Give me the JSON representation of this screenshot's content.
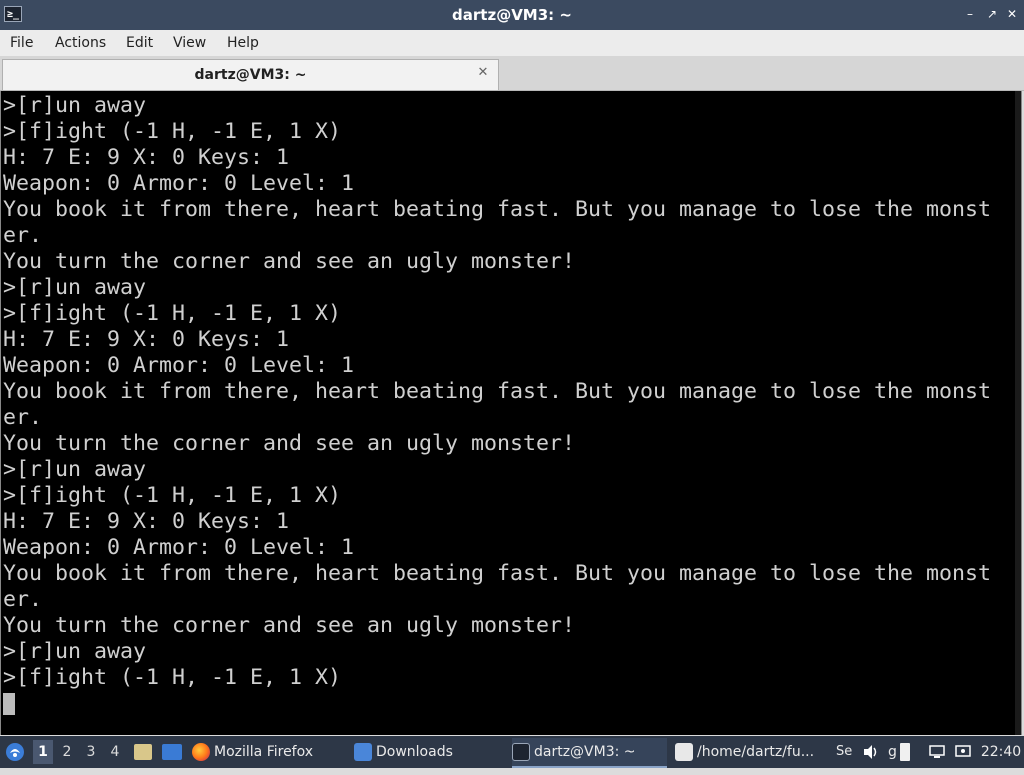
{
  "window": {
    "title": "dartz@VM3: ~",
    "app_icon_glyph": "≥_",
    "controls": [
      "–",
      "↗",
      "✕"
    ]
  },
  "menu": [
    "File",
    "Actions",
    "Edit",
    "View",
    "Help"
  ],
  "tab": {
    "label": "dartz@VM3: ~",
    "close_glyph": "✕"
  },
  "terminal": {
    "lines": [
      ">[r]un away",
      ">[f]ight (-1 H, -1 E, 1 X)",
      "H: 7 E: 9 X: 0 Keys: 1",
      "Weapon: 0 Armor: 0 Level: 1",
      "You book it from there, heart beating fast. But you manage to lose the monst",
      "er.",
      "You turn the corner and see an ugly monster!",
      ">[r]un away",
      ">[f]ight (-1 H, -1 E, 1 X)",
      "H: 7 E: 9 X: 0 Keys: 1",
      "Weapon: 0 Armor: 0 Level: 1",
      "You book it from there, heart beating fast. But you manage to lose the monst",
      "er.",
      "You turn the corner and see an ugly monster!",
      ">[r]un away",
      ">[f]ight (-1 H, -1 E, 1 X)",
      "H: 7 E: 9 X: 0 Keys: 1",
      "Weapon: 0 Armor: 0 Level: 1",
      "You book it from there, heart beating fast. But you manage to lose the monst",
      "er.",
      "You turn the corner and see an ugly monster!",
      ">[r]un away",
      ">[f]ight (-1 H, -1 E, 1 X)"
    ]
  },
  "taskbar": {
    "workspaces": [
      "1",
      "2",
      "3",
      "4"
    ],
    "active_workspace": "1",
    "tasks": [
      {
        "label": "Mozilla Firefox",
        "icon": "firefox-icon"
      },
      {
        "label": "Downloads",
        "icon": "folder-icon"
      },
      {
        "label": "dartz@VM3: ~",
        "icon": "terminal-icon"
      },
      {
        "label": "/home/dartz/fu...",
        "icon": "text-editor-icon"
      }
    ],
    "tray_text_1": "Se",
    "tray_text_2": "g",
    "clock": "22:40"
  },
  "colors": {
    "titlebar": "#3b4a60",
    "terminal_bg": "#000000",
    "terminal_fg": "#d0d0d0",
    "taskbar": "#2d3747"
  }
}
